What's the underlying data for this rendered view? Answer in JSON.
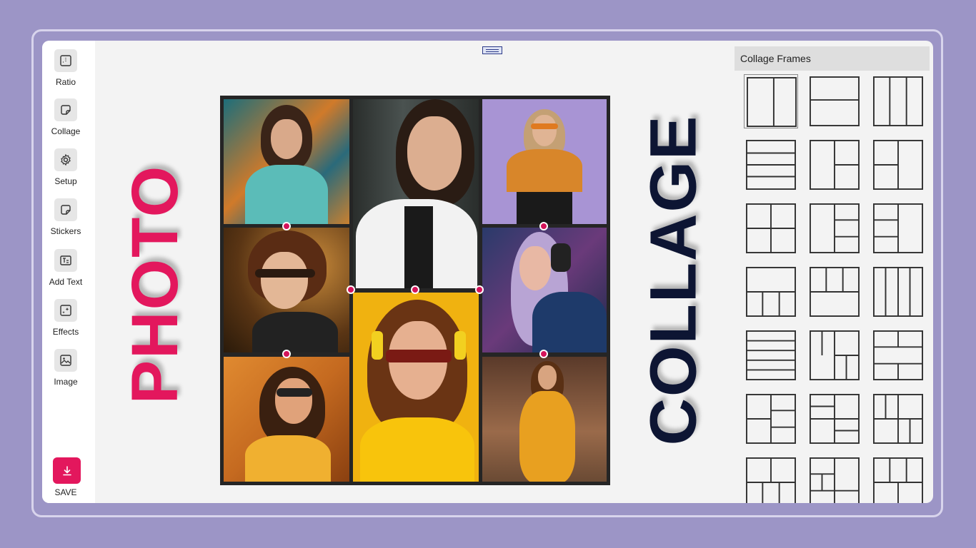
{
  "toolbar": {
    "items": [
      {
        "label": "Ratio",
        "icon": "ratio-icon"
      },
      {
        "label": "Collage",
        "icon": "collage-icon"
      },
      {
        "label": "Setup",
        "icon": "gear-icon"
      },
      {
        "label": "Stickers",
        "icon": "sticker-icon"
      },
      {
        "label": "Add Text",
        "icon": "text-icon"
      },
      {
        "label": "Effects",
        "icon": "effects-icon"
      },
      {
        "label": "Image",
        "icon": "image-icon"
      }
    ],
    "save_label": "SAVE"
  },
  "canvas": {
    "title_left": "PHOTO",
    "title_right": "COLLAGE"
  },
  "frames_panel": {
    "header": "Collage Frames",
    "selected_index": 0
  },
  "colors": {
    "background": "#9c95c6",
    "accent": "#e3175d",
    "dark_text": "#0d1533"
  }
}
